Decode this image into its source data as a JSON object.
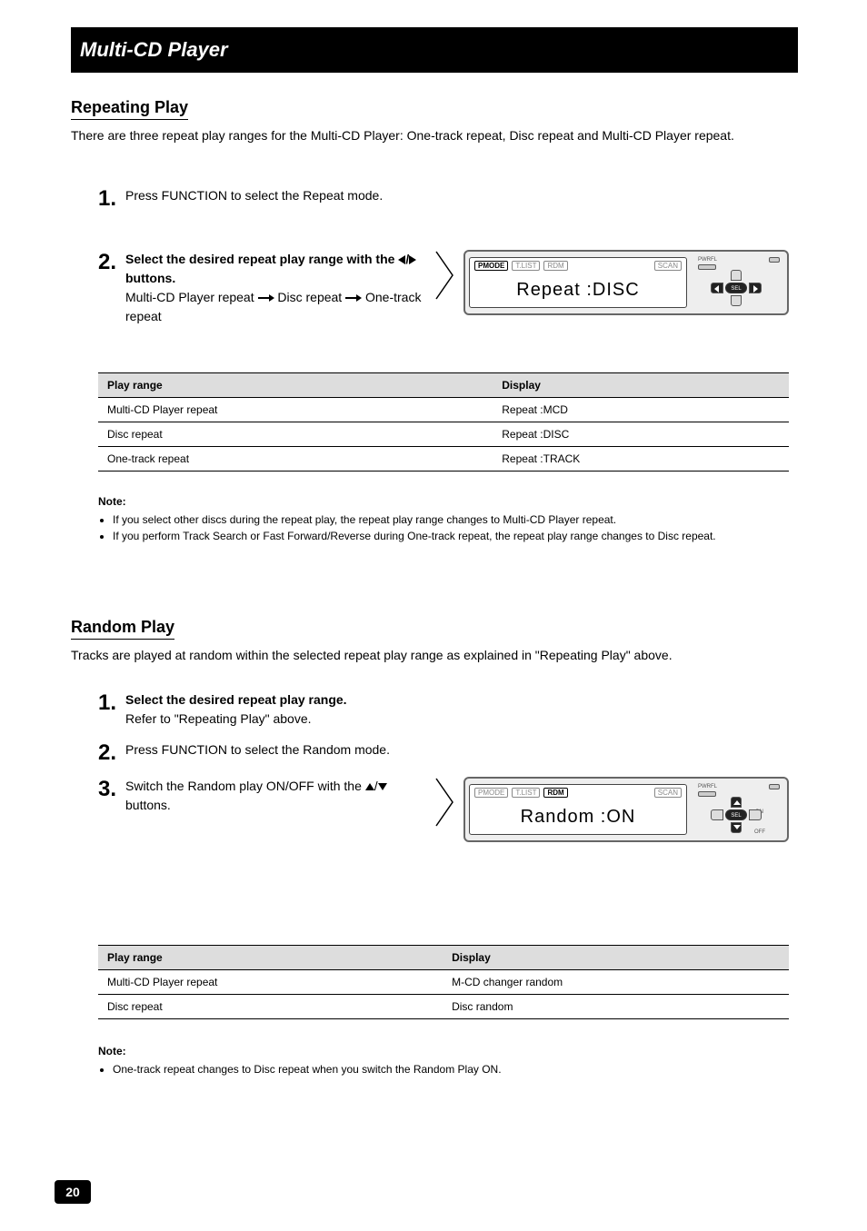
{
  "header": {
    "title": "Multi-CD Player"
  },
  "section1": {
    "heading": "Repeating Play",
    "intro": "There are three repeat play ranges for the Multi-CD Player: One-track repeat, Disc repeat and Multi-CD Player repeat.",
    "step1": {
      "label": "Press FUNCTION to select the Repeat mode."
    },
    "step2": {
      "label_pre": "Select the desired repeat play range with the ",
      "label_mid": " buttons.",
      "seq_a": "Multi-CD Player repeat",
      "seq_b": "Disc repeat",
      "seq_c": "One-track repeat"
    },
    "lcd": {
      "badges": {
        "pmode": "PMODE",
        "tlist": "T.LIST",
        "rdm": "RDM",
        "scan": "SCAN"
      },
      "main": "Repeat   :DISC"
    },
    "table": {
      "h1": "Play range",
      "h2": "Display",
      "rows": [
        {
          "c1": "Multi-CD Player repeat",
          "c2": "Repeat :MCD"
        },
        {
          "c1": "Disc repeat",
          "c2": "Repeat :DISC"
        },
        {
          "c1": "One-track repeat",
          "c2": "Repeat :TRACK"
        }
      ]
    },
    "note": {
      "heading": "Note:",
      "items": [
        "If you select other discs during the repeat play, the repeat play range changes to Multi-CD Player repeat.",
        "If you perform Track Search or Fast Forward/Reverse during One-track repeat, the repeat play range changes to Disc repeat."
      ]
    }
  },
  "section2": {
    "heading": "Random Play",
    "intro": "Tracks are played at random within the selected repeat play range as explained in \"Repeating Play\" above.",
    "step1": {
      "label_pre": "Select the desired repeat play range.",
      "label_ref": "Refer to \"Repeating Play\" above."
    },
    "step2": {
      "label": "Press FUNCTION to select the Random mode."
    },
    "step3": {
      "label_pre": "Switch the Random play ON/OFF with the ",
      "label_post": " buttons."
    },
    "lcd": {
      "badges": {
        "pmode": "PMODE",
        "tlist": "T.LIST",
        "rdm": "RDM",
        "scan": "SCAN"
      },
      "main": "Random   :ON"
    },
    "table": {
      "h1": "Play range",
      "h2": "Display",
      "rows": [
        {
          "c1": "Multi-CD Player repeat",
          "c2": "M-CD changer random"
        },
        {
          "c1": "Disc repeat",
          "c2": "Disc random"
        }
      ]
    },
    "note": {
      "heading": "Note:",
      "items": [
        "One-track repeat changes to Disc repeat when you switch the Random Play ON."
      ]
    }
  },
  "controls": {
    "pwrfl": "PWRFL",
    "sel": "SEL",
    "on": "ON",
    "off": "OFF"
  },
  "page_number": "20"
}
